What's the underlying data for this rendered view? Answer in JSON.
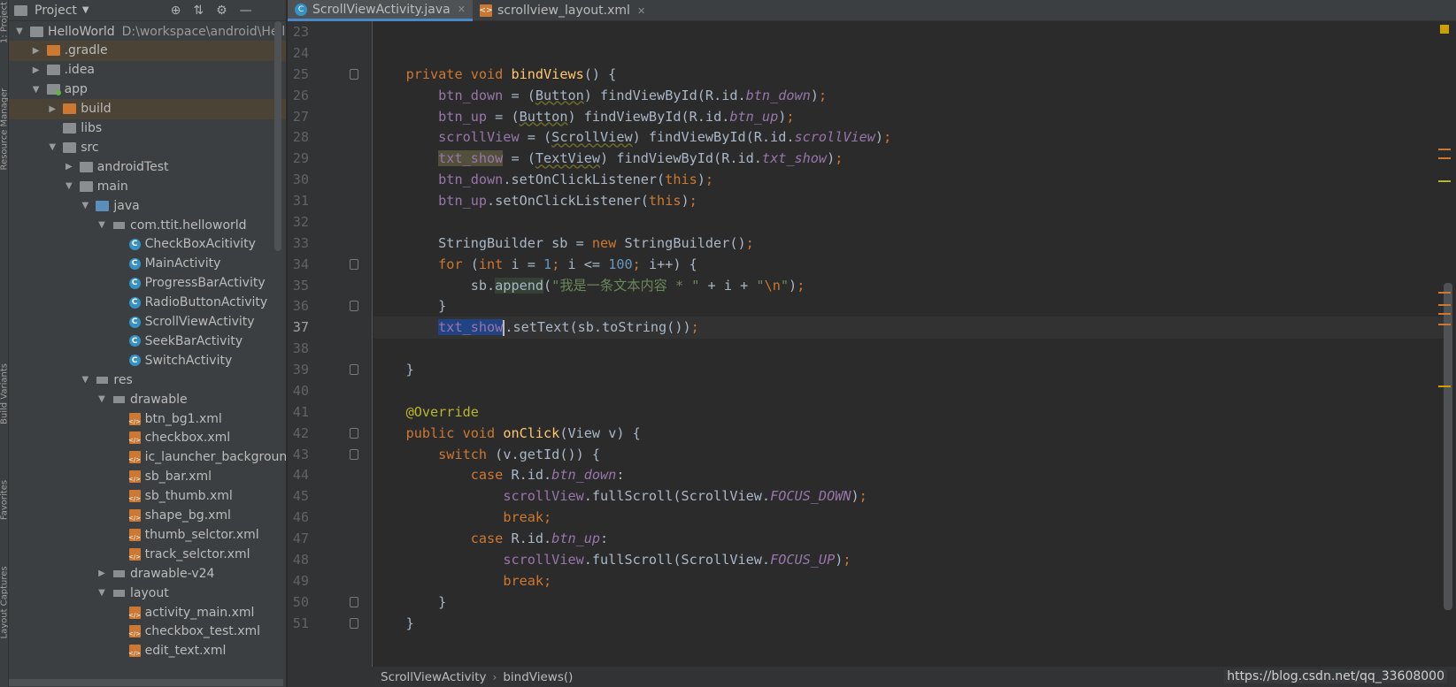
{
  "side_tabs": [
    "1: Project",
    "Resource Manager",
    "Build Variants",
    "Favorites",
    "Layout Captures"
  ],
  "project_panel": {
    "title": "Project",
    "tree": [
      {
        "depth": 0,
        "arrow": "down",
        "icon": "f-gray",
        "label": "HelloWorld",
        "path": "D:\\workspace\\android\\HelloWorld"
      },
      {
        "depth": 1,
        "arrow": "right",
        "icon": "f-orange",
        "label": ".gradle",
        "selected": true
      },
      {
        "depth": 1,
        "arrow": "right",
        "icon": "f-gray",
        "label": ".idea"
      },
      {
        "depth": 1,
        "arrow": "down",
        "icon": "app",
        "label": "app"
      },
      {
        "depth": 2,
        "arrow": "right",
        "icon": "f-orange",
        "label": "build",
        "selected": true
      },
      {
        "depth": 2,
        "arrow": "",
        "icon": "f-gray",
        "label": "libs"
      },
      {
        "depth": 2,
        "arrow": "down",
        "icon": "f-gray",
        "label": "src"
      },
      {
        "depth": 3,
        "arrow": "right",
        "icon": "f-gray",
        "label": "androidTest"
      },
      {
        "depth": 3,
        "arrow": "down",
        "icon": "f-gray",
        "label": "main"
      },
      {
        "depth": 4,
        "arrow": "down",
        "icon": "f-blue",
        "label": "java"
      },
      {
        "depth": 5,
        "arrow": "down",
        "icon": "f-grid",
        "label": "com.ttit.helloworld"
      },
      {
        "depth": 6,
        "arrow": "",
        "icon": "cls",
        "label": "CheckBoxAcitivity"
      },
      {
        "depth": 6,
        "arrow": "",
        "icon": "cls",
        "label": "MainActivity"
      },
      {
        "depth": 6,
        "arrow": "",
        "icon": "cls",
        "label": "ProgressBarActivity"
      },
      {
        "depth": 6,
        "arrow": "",
        "icon": "cls",
        "label": "RadioButtonActivity"
      },
      {
        "depth": 6,
        "arrow": "",
        "icon": "cls",
        "label": "ScrollViewActivity"
      },
      {
        "depth": 6,
        "arrow": "",
        "icon": "cls",
        "label": "SeekBarActivity"
      },
      {
        "depth": 6,
        "arrow": "",
        "icon": "cls",
        "label": "SwitchActivity"
      },
      {
        "depth": 4,
        "arrow": "down",
        "icon": "f-grid",
        "label": "res"
      },
      {
        "depth": 5,
        "arrow": "down",
        "icon": "f-grid",
        "label": "drawable"
      },
      {
        "depth": 6,
        "arrow": "",
        "icon": "xml",
        "label": "btn_bg1.xml"
      },
      {
        "depth": 6,
        "arrow": "",
        "icon": "xml",
        "label": "checkbox.xml"
      },
      {
        "depth": 6,
        "arrow": "",
        "icon": "xml",
        "label": "ic_launcher_background.xml"
      },
      {
        "depth": 6,
        "arrow": "",
        "icon": "xml",
        "label": "sb_bar.xml"
      },
      {
        "depth": 6,
        "arrow": "",
        "icon": "xml",
        "label": "sb_thumb.xml"
      },
      {
        "depth": 6,
        "arrow": "",
        "icon": "xml",
        "label": "shape_bg.xml"
      },
      {
        "depth": 6,
        "arrow": "",
        "icon": "xml",
        "label": "thumb_selctor.xml"
      },
      {
        "depth": 6,
        "arrow": "",
        "icon": "xml",
        "label": "track_selctor.xml"
      },
      {
        "depth": 5,
        "arrow": "right",
        "icon": "f-grid",
        "label": "drawable-v24"
      },
      {
        "depth": 5,
        "arrow": "down",
        "icon": "f-grid",
        "label": "layout"
      },
      {
        "depth": 6,
        "arrow": "",
        "icon": "xml",
        "label": "activity_main.xml"
      },
      {
        "depth": 6,
        "arrow": "",
        "icon": "xml",
        "label": "checkbox_test.xml"
      },
      {
        "depth": 6,
        "arrow": "",
        "icon": "xml",
        "label": "edit_text.xml"
      }
    ]
  },
  "tabs": [
    {
      "label": "ScrollViewActivity.java",
      "icon": "java-class-icon",
      "active": true
    },
    {
      "label": "scrollview_layout.xml",
      "icon": "xml-file-icon",
      "active": false
    }
  ],
  "current_line": 37,
  "code": [
    {
      "n": 23,
      "t": []
    },
    {
      "n": 24,
      "t": []
    },
    {
      "n": 25,
      "fold": true,
      "t": [
        [
          "    ",
          ""
        ],
        [
          "private void ",
          "kw"
        ],
        [
          "bindViews",
          "fn"
        ],
        [
          "() {",
          ""
        ]
      ]
    },
    {
      "n": 26,
      "t": [
        [
          "        ",
          ""
        ],
        [
          "btn_down",
          "fld"
        ],
        [
          " = (",
          ""
        ],
        [
          "Button",
          "sq"
        ],
        [
          ") findViewById(R.id.",
          ""
        ],
        [
          "btn_down",
          "ital"
        ],
        [
          ")",
          ""
        ],
        [
          ";",
          "kw"
        ]
      ]
    },
    {
      "n": 27,
      "t": [
        [
          "        ",
          ""
        ],
        [
          "btn_up",
          "fld"
        ],
        [
          " = (",
          ""
        ],
        [
          "Button",
          "sq"
        ],
        [
          ") findViewById(R.id.",
          ""
        ],
        [
          "btn_up",
          "ital"
        ],
        [
          ")",
          ""
        ],
        [
          ";",
          "kw"
        ]
      ]
    },
    {
      "n": 28,
      "t": [
        [
          "        ",
          ""
        ],
        [
          "scrollView",
          "fld"
        ],
        [
          " = (",
          ""
        ],
        [
          "ScrollView",
          "sq"
        ],
        [
          ") findViewById(R.id.",
          ""
        ],
        [
          "scrollView",
          "ital"
        ],
        [
          ")",
          ""
        ],
        [
          ";",
          "kw"
        ]
      ]
    },
    {
      "n": 29,
      "t": [
        [
          "        ",
          ""
        ],
        [
          "txt_show",
          "fld wr"
        ],
        [
          " = (",
          ""
        ],
        [
          "TextView",
          "sq"
        ],
        [
          ") findViewById(R.id.",
          ""
        ],
        [
          "txt_show",
          "ital"
        ],
        [
          ")",
          ""
        ],
        [
          ";",
          "kw"
        ]
      ]
    },
    {
      "n": 30,
      "t": [
        [
          "        ",
          ""
        ],
        [
          "btn_down",
          "fld"
        ],
        [
          ".setOnClickListener(",
          ""
        ],
        [
          "this",
          "kw"
        ],
        [
          ")",
          ""
        ],
        [
          ";",
          "kw"
        ]
      ]
    },
    {
      "n": 31,
      "t": [
        [
          "        ",
          ""
        ],
        [
          "btn_up",
          "fld"
        ],
        [
          ".setOnClickListener(",
          ""
        ],
        [
          "this",
          "kw"
        ],
        [
          ")",
          ""
        ],
        [
          ";",
          "kw"
        ]
      ]
    },
    {
      "n": 32,
      "t": []
    },
    {
      "n": 33,
      "t": [
        [
          "        StringBuilder sb = ",
          ""
        ],
        [
          "new ",
          "kw"
        ],
        [
          "StringBuilder()",
          ""
        ],
        [
          ";",
          "kw"
        ]
      ]
    },
    {
      "n": 34,
      "fold": true,
      "t": [
        [
          "        ",
          ""
        ],
        [
          "for ",
          "kw"
        ],
        [
          "(",
          ""
        ],
        [
          "int ",
          "kw"
        ],
        [
          "i = ",
          ""
        ],
        [
          "1",
          "num"
        ],
        [
          "; ",
          "kw"
        ],
        [
          "i <= ",
          ""
        ],
        [
          "100",
          "num"
        ],
        [
          "; ",
          "kw"
        ],
        [
          "i++) {",
          ""
        ]
      ]
    },
    {
      "n": 35,
      "t": [
        [
          "            sb.",
          ""
        ],
        [
          "append",
          "hl2"
        ],
        [
          "(",
          ""
        ],
        [
          "\"我是一条文本内容 * \"",
          "str"
        ],
        [
          " + i + ",
          ""
        ],
        [
          "\"",
          "str"
        ],
        [
          "\\n",
          "kw"
        ],
        [
          "\"",
          "str"
        ],
        [
          ")",
          ""
        ],
        [
          ";",
          "kw"
        ]
      ]
    },
    {
      "n": 36,
      "fold": true,
      "t": [
        [
          "        }",
          ""
        ]
      ]
    },
    {
      "n": 37,
      "cur": true,
      "t": [
        [
          "        ",
          ""
        ],
        [
          "txt_show",
          "fld hl"
        ],
        [
          "|caret",
          ""
        ],
        [
          ".setText(sb.toString())",
          ""
        ],
        [
          ";",
          "kw"
        ]
      ]
    },
    {
      "n": 38,
      "t": []
    },
    {
      "n": 39,
      "fold": true,
      "t": [
        [
          "    }",
          ""
        ]
      ]
    },
    {
      "n": 40,
      "t": []
    },
    {
      "n": 41,
      "t": [
        [
          "    ",
          ""
        ],
        [
          "@Override",
          "ann"
        ]
      ]
    },
    {
      "n": 42,
      "fold": true,
      "marks": true,
      "t": [
        [
          "    ",
          ""
        ],
        [
          "public void ",
          "kw"
        ],
        [
          "onClick",
          "fn"
        ],
        [
          "(View v) {",
          ""
        ]
      ]
    },
    {
      "n": 43,
      "fold": true,
      "t": [
        [
          "        ",
          ""
        ],
        [
          "switch ",
          "kw"
        ],
        [
          "(v.getId()) {",
          ""
        ]
      ]
    },
    {
      "n": 44,
      "t": [
        [
          "            ",
          ""
        ],
        [
          "case ",
          "kw"
        ],
        [
          "R.id.",
          ""
        ],
        [
          "btn_down",
          "ital"
        ],
        [
          ":",
          ""
        ]
      ]
    },
    {
      "n": 45,
      "t": [
        [
          "                ",
          ""
        ],
        [
          "scrollView",
          "fld"
        ],
        [
          ".fullScroll(ScrollView.",
          ""
        ],
        [
          "FOCUS_DOWN",
          "ital"
        ],
        [
          ")",
          ""
        ],
        [
          ";",
          "kw"
        ]
      ]
    },
    {
      "n": 46,
      "t": [
        [
          "                ",
          ""
        ],
        [
          "break;",
          "kw"
        ]
      ]
    },
    {
      "n": 47,
      "t": [
        [
          "            ",
          ""
        ],
        [
          "case ",
          "kw"
        ],
        [
          "R.id.",
          ""
        ],
        [
          "btn_up",
          "ital"
        ],
        [
          ":",
          ""
        ]
      ]
    },
    {
      "n": 48,
      "t": [
        [
          "                ",
          ""
        ],
        [
          "scrollView",
          "fld"
        ],
        [
          ".fullScroll(ScrollView.",
          ""
        ],
        [
          "FOCUS_UP",
          "ital"
        ],
        [
          ")",
          ""
        ],
        [
          ";",
          "kw"
        ]
      ]
    },
    {
      "n": 49,
      "t": [
        [
          "                ",
          ""
        ],
        [
          "break;",
          "kw"
        ]
      ]
    },
    {
      "n": 50,
      "fold": true,
      "t": [
        [
          "        }",
          ""
        ]
      ]
    },
    {
      "n": 51,
      "fold": true,
      "t": [
        [
          "    }",
          ""
        ]
      ]
    }
  ],
  "gutter_icons": {
    "implements": "↑",
    "annotation": "@"
  },
  "breadcrumb": [
    "ScrollViewActivity",
    "bindViews()"
  ],
  "watermark": "https://blog.csdn.net/qq_33608000",
  "colors": {
    "keyword": "#cc7832",
    "field": "#9876aa",
    "function": "#ffc66d",
    "number": "#6897bb",
    "string": "#6a8759",
    "annotation": "#bbb529",
    "selection": "#214283"
  }
}
